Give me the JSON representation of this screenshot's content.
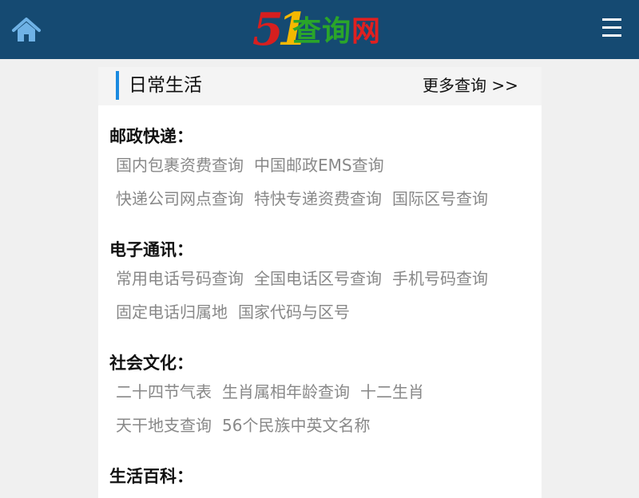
{
  "header": {
    "logo": {
      "digits": [
        "5",
        "1"
      ],
      "chars": [
        "查",
        "询",
        "网"
      ]
    },
    "home_icon": "home-icon",
    "menu_icon": "hamburger-menu-icon",
    "colors": {
      "bar": "#154a72",
      "home": "#6fb2e6",
      "accent": "#1a8ae0"
    }
  },
  "card": {
    "title": "日常生活",
    "more": "更多查询 >>",
    "sections": [
      {
        "title": "邮政快递：",
        "rows": [
          [
            "国内包裹资费查询",
            "中国邮政EMS查询"
          ],
          [
            "快递公司网点查询",
            "特快专递资费查询",
            "国际区号查询"
          ]
        ]
      },
      {
        "title": "电子通讯：",
        "rows": [
          [
            "常用电话号码查询",
            "全国电话区号查询",
            "手机号码查询"
          ],
          [
            "固定电话归属地",
            "国家代码与区号"
          ]
        ]
      },
      {
        "title": "社会文化：",
        "rows": [
          [
            "二十四节气表",
            "生肖属相年龄查询",
            "十二生肖"
          ],
          [
            "天干地支查询",
            "56个民族中英文名称"
          ]
        ]
      },
      {
        "title": "生活百科：",
        "rows": []
      }
    ]
  }
}
